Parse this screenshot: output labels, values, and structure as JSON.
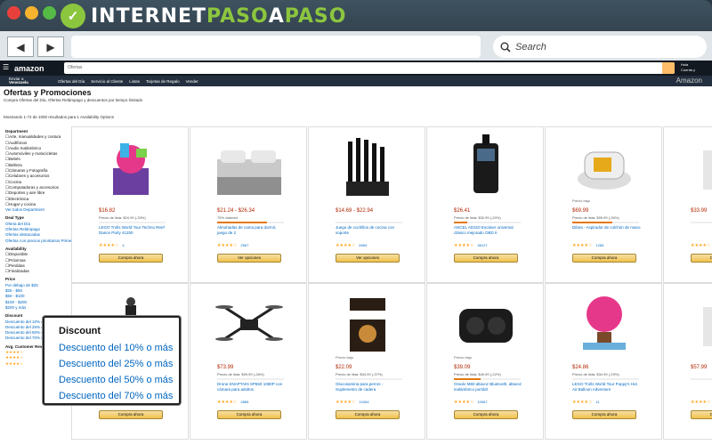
{
  "window": {
    "logo": {
      "part1": "INTERNET",
      "part2": "PASO",
      "part3": "A",
      "part4": "PASO"
    }
  },
  "browser": {
    "back_icon": "◀",
    "forward_icon": "▶",
    "search_icon": "⚲",
    "search_label": "Search"
  },
  "amazon": {
    "logo": "amazon",
    "search_category": "Ofertas",
    "hello": [
      "Hola",
      "Cuenta y"
    ],
    "nav_location": [
      "Enviar a",
      "Venezuela"
    ],
    "nav": [
      "Ofertas del Día",
      "Servicio al Cliente",
      "Listas",
      "Tarjetas de Regalo",
      "Vender"
    ],
    "nav_right": "Amazon"
  },
  "page": {
    "title": "Ofertas y Promociones",
    "subtitle": "Compra Ofertas del Día, Ofertas Relámpago y descuentos por tiempo limitado",
    "results": "Mostrando 1-72 de 1000 resultados para 1 Availability Options",
    "results_link": "1 Availability Options"
  },
  "sidebar": {
    "department_header": "Department",
    "departments": [
      "Arte, manualidades y costura",
      "Audífonos",
      "Audio Inalámbrico",
      "Automóviles y motocicletas",
      "Bebés",
      "Belleza",
      "Cámaras y Fotografía",
      "Celulares y accesorios",
      "Cocina",
      "Computadoras y accesorios",
      "Deportes y aire libre",
      "Electrónica",
      "Hogar y cocina"
    ],
    "departments_more": "Ver todos Department",
    "deal_type_header": "Deal Type",
    "deal_types": [
      "Oferta del Día",
      "Ofertas Relámpago",
      "Ofertas destacadas",
      "Ofertas con precios prioritarios Prime"
    ],
    "availability_header": "Availability",
    "availability": [
      "Disponible",
      "Próximas",
      "Perdidas",
      "Finalizadas"
    ],
    "price_header": "Price",
    "prices": [
      "Por debajo de $25",
      "$25 - $50",
      "$50 - $100",
      "$100 - $200",
      "$200 y más"
    ],
    "discount_header": "Discount",
    "discounts": [
      "Descuento del 10% o más",
      "Descuento del 25% o más",
      "Descuento del 50% o más",
      "Descuento del 70% o más"
    ],
    "rating_header": "Avg. Customer Review"
  },
  "popup": {
    "header": "Discount",
    "options": [
      "Descuento del 10% o más",
      "Descuento del 25% o más",
      "Descuento del 50% o más",
      "Descuento del 70% o más"
    ]
  },
  "products": [
    {
      "badge": "",
      "price": "$16.82",
      "meta": "Precio de lista: $24.99 (-33%)",
      "claimed": 0.0,
      "title": "LEGO Trolls World Tour Techno Reef Dance Party 41250",
      "stars": "★★★★☆",
      "reviews": "4",
      "button": "Compra ahora",
      "art": "lego-set"
    },
    {
      "badge": "",
      "price": "$21.24 - $26.34",
      "meta": "75% claimed",
      "claimed": 0.75,
      "title": "Almohadas de cama para dormir, juego de 2",
      "stars": "★★★★☆",
      "reviews": "2567",
      "button": "Ver opciones",
      "art": "bedding"
    },
    {
      "badge": "",
      "price": "$14.69 - $22.94",
      "meta": "",
      "claimed": 0.0,
      "title": "Juego de cuchillos de cocina con soporte",
      "stars": "★★★★☆",
      "reviews": "6954",
      "button": "Ver opciones",
      "art": "knives"
    },
    {
      "badge": "",
      "price": "$26.41",
      "meta": "Precio de lista: $32.99 (-20%)",
      "claimed": 0.2,
      "title": "ANCEL AD310 Escáner universal clásico mejorado OBD II",
      "stars": "★★★★☆",
      "reviews": "36127",
      "button": "Compra ahora",
      "art": "scanner"
    },
    {
      "badge": "Precio bajo",
      "price": "$69.99",
      "meta": "Precio de lista: $99.99 (-30%)",
      "claimed": 0.6,
      "title": "Dibea - Aspirador de colchón de mano",
      "stars": "★★★★☆",
      "reviews": "1265",
      "button": "Compra ahora",
      "art": "vacuum"
    },
    {
      "badge": "",
      "price": "$33.99",
      "meta": "",
      "claimed": 0.0,
      "title": "",
      "stars": "★★★★☆",
      "reviews": "",
      "button": "Compra ahora",
      "art": "misc"
    },
    {
      "badge": "",
      "price": "",
      "meta": "",
      "claimed": 0.0,
      "title": "",
      "stars": "",
      "reviews": "",
      "button": "Compra ahora",
      "art": "bottle"
    },
    {
      "badge": "",
      "price": "$73.99",
      "meta": "Precio de lista: $99.99 (-26%)",
      "claimed": 0.0,
      "title": "Drone SNAPTAIN SP650 1080P con cámara para adultos",
      "stars": "★★★★☆",
      "reviews": "2865",
      "button": "Compra ahora",
      "art": "drone"
    },
    {
      "badge": "Precio bajo",
      "price": "$22.09",
      "meta": "Precio de lista: $34.99 (-37%)",
      "claimed": 0.0,
      "title": "Glucosamina para perros - Suplemento de cadera",
      "stars": "★★★★☆",
      "reviews": "10454",
      "button": "Compra ahora",
      "art": "supplement"
    },
    {
      "badge": "Precio bajo",
      "price": "$39.09",
      "meta": "Precio de lista: $49.99 (-22%)",
      "claimed": 0.4,
      "title": "Oraolo M60 altavoz Bluetooth, altavoz inalámbrico portátil",
      "stars": "★★★★☆",
      "reviews": "10967",
      "button": "Compra ahora",
      "art": "speaker"
    },
    {
      "badge": "",
      "price": "$24.86",
      "meta": "Precio de lista: $34.99 (-29%)",
      "claimed": 0.0,
      "title": "LEGO Trolls World Tour Poppy's Hot Air Balloon Adventure",
      "stars": "★★★★☆",
      "reviews": "11",
      "button": "Compra ahora",
      "art": "balloon"
    },
    {
      "badge": "",
      "price": "$57.99",
      "meta": "",
      "claimed": 0.0,
      "title": "",
      "stars": "★★★★☆",
      "reviews": "",
      "button": "Compra ahora",
      "art": "misc"
    }
  ]
}
